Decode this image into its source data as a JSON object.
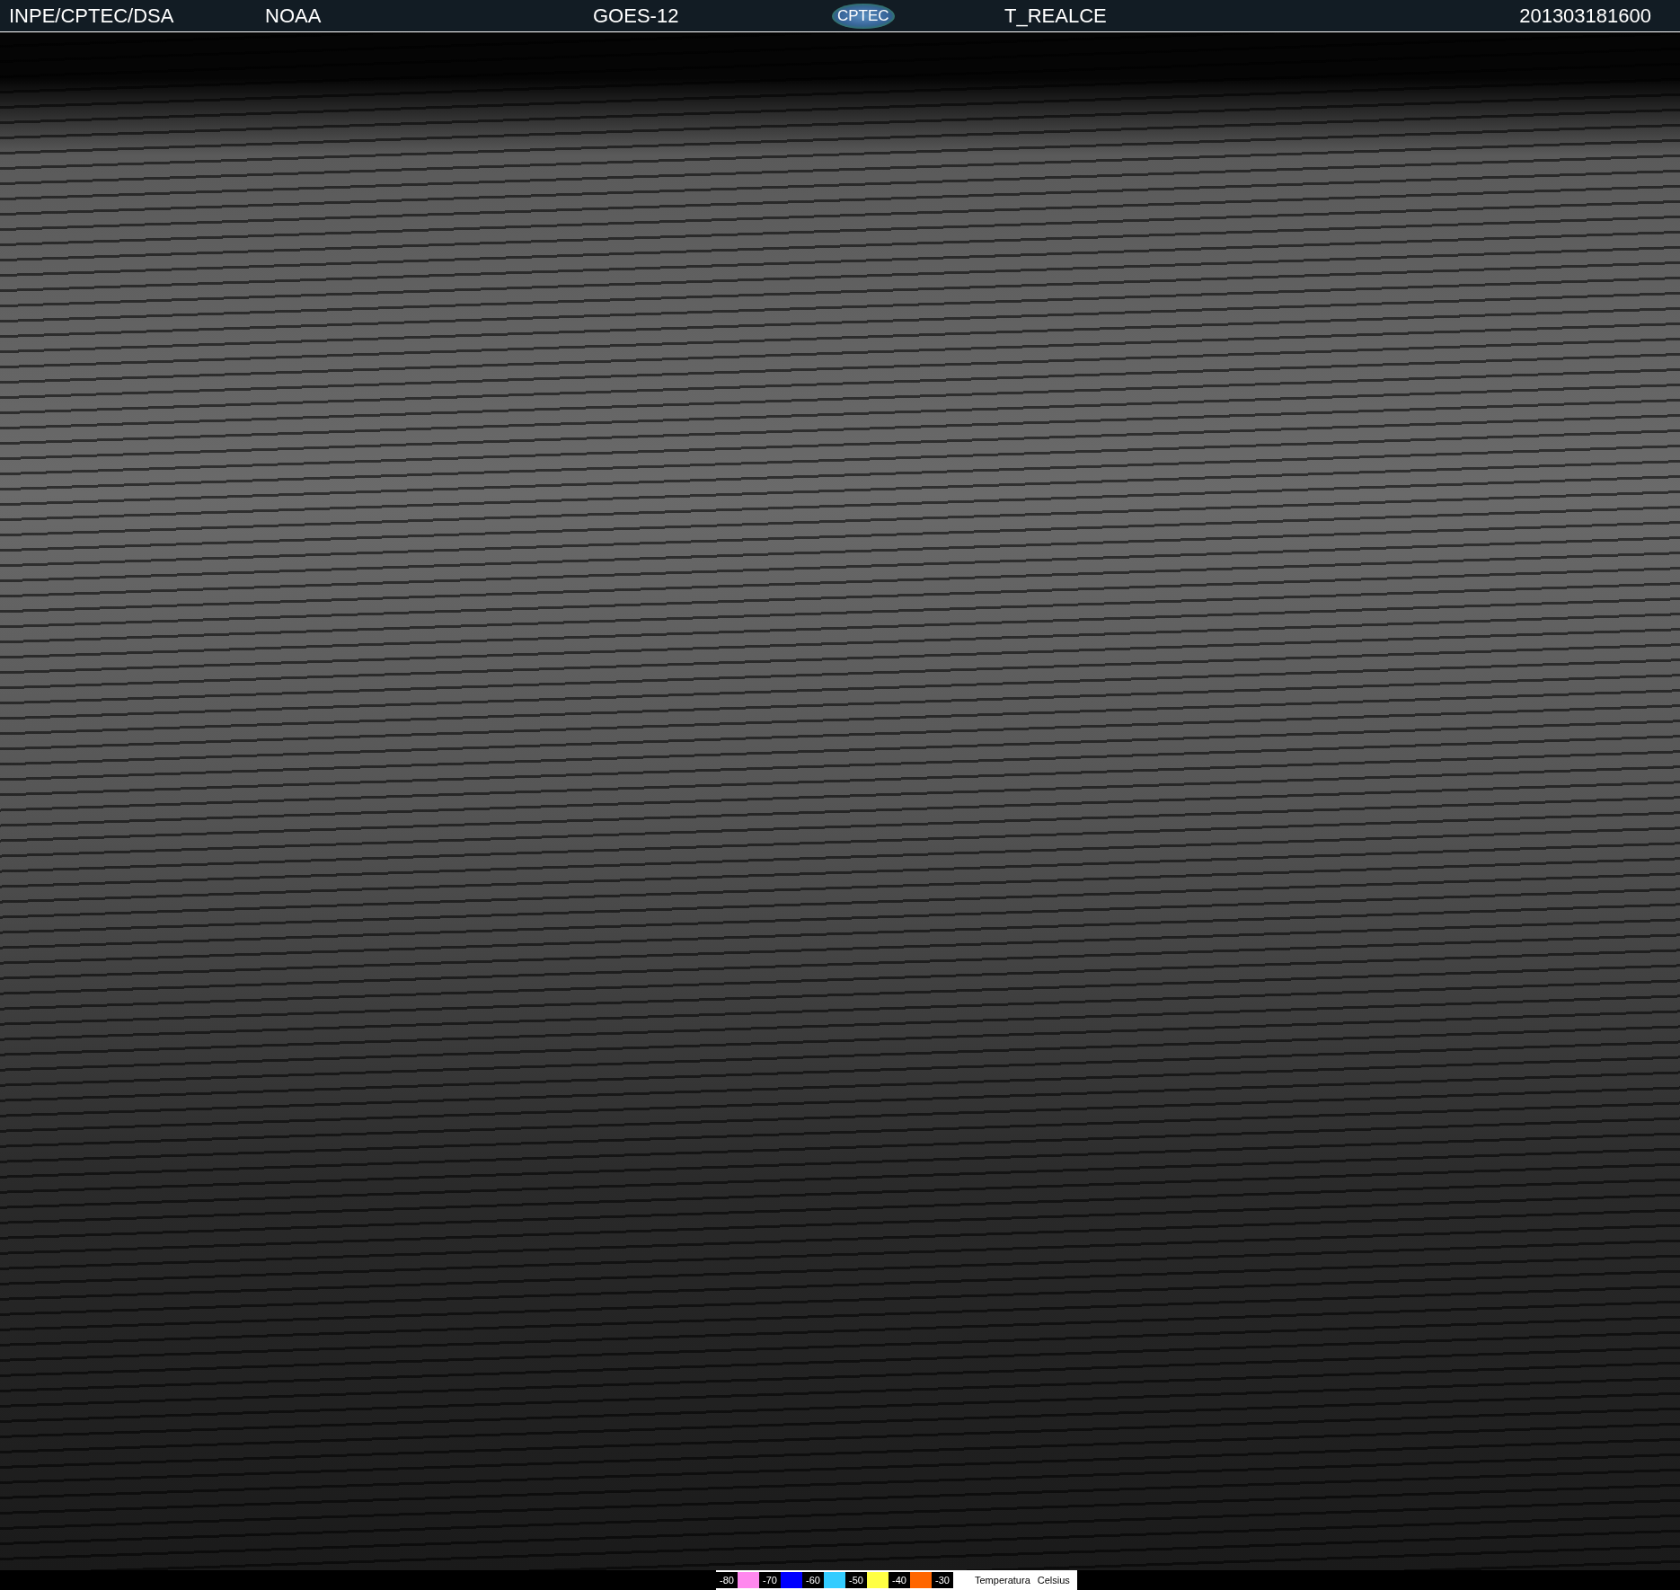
{
  "header": {
    "source": "INPE/CPTEC/DSA",
    "agency": "NOAA",
    "satellite": "GOES-12",
    "logo": "CPTEC",
    "product": "T_REALCE",
    "timestamp": "201303181600"
  },
  "legend": {
    "scale": [
      {
        "label": "-80",
        "color": "#ff88ee"
      },
      {
        "label": "-70",
        "color": "#0000ff"
      },
      {
        "label": "-60",
        "color": "#33ccff"
      },
      {
        "label": "-50",
        "color": "#ffff44"
      },
      {
        "label": "-40",
        "color": "#ff6600"
      },
      {
        "label": "-30"
      }
    ],
    "title": "Temperatura",
    "unit": "Celsius"
  }
}
